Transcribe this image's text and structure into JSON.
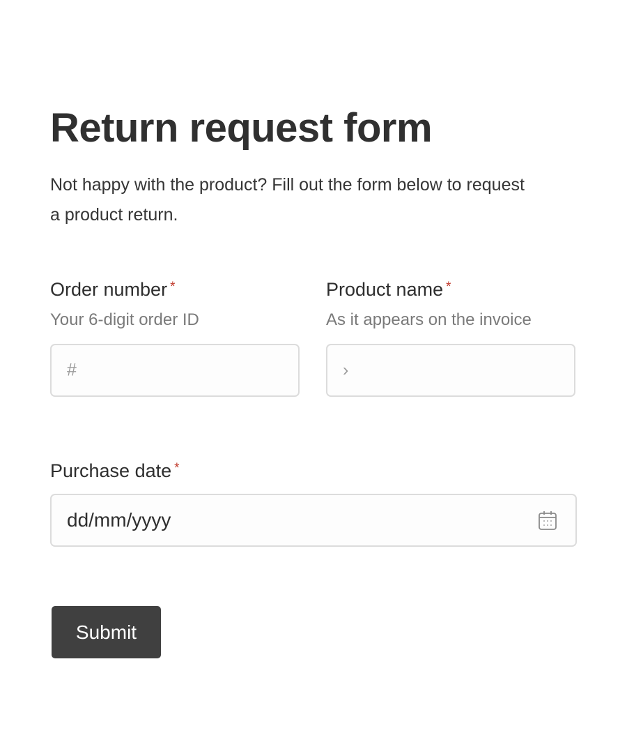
{
  "form": {
    "title": "Return request form",
    "intro": "Not happy with the product? Fill out the form below to request a product return."
  },
  "fields": {
    "order_number": {
      "label": "Order number",
      "required_mark": "*",
      "hint": "Your 6-digit order ID",
      "prefix": "#",
      "value": ""
    },
    "product_name": {
      "label": "Product name",
      "required_mark": "*",
      "hint": "As it appears on the invoice",
      "prefix": "›",
      "value": ""
    },
    "purchase_date": {
      "label": "Purchase date",
      "required_mark": "*",
      "value": "dd/mm/yyyy",
      "icon": "calendar-icon"
    }
  },
  "actions": {
    "submit_label": "Submit"
  },
  "colors": {
    "required": "#c0392b",
    "button_bg": "#404040",
    "input_border": "#dcdcdc",
    "hint_text": "#7a7a7a"
  }
}
